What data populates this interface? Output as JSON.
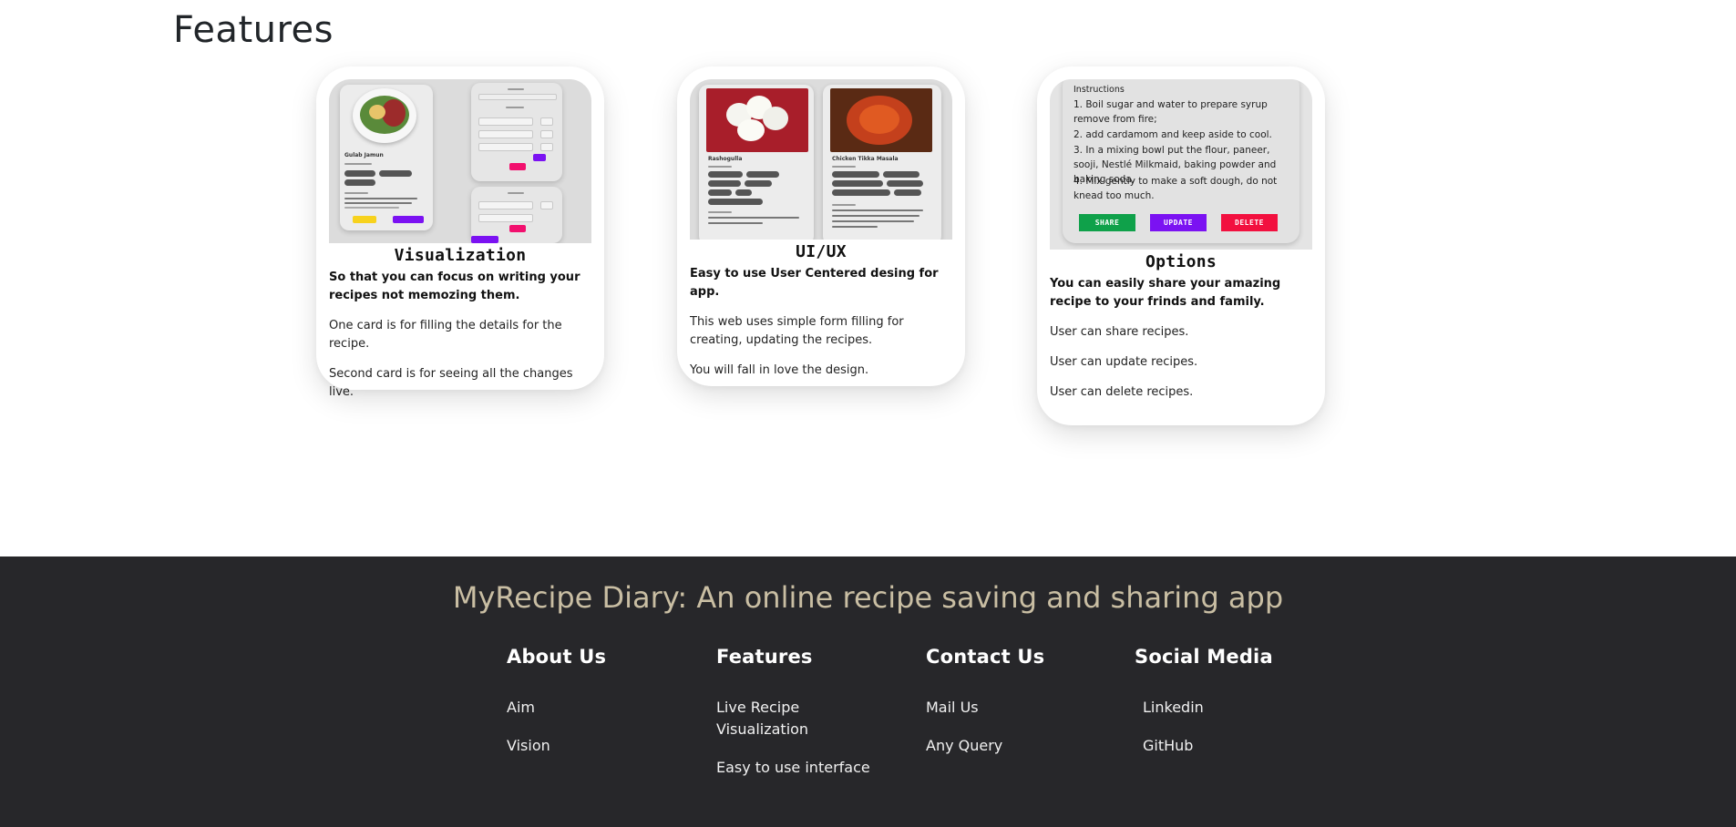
{
  "page": {
    "heading": "Features"
  },
  "cards": [
    {
      "title": "Visualization",
      "lead": "So that you can focus on writing your recipes not memozing them.",
      "paragraphs": [
        "One card is for filling the details for the recipe.",
        "Second card is for seeing all the changes live."
      ]
    },
    {
      "title": "UI/UX",
      "lead": "Easy to use User Centered desing for app.",
      "paragraphs": [
        "This web uses simple form filling for creating, updating the recipes.",
        "You will fall in love the design."
      ]
    },
    {
      "title": "Options",
      "lead": "You can easily share your amazing recipe to your frinds and family.",
      "paragraphs": [
        "User can share recipes.",
        "User can update recipes.",
        "User can delete recipes."
      ]
    }
  ],
  "options_preview": {
    "heading": "Instructions",
    "steps": [
      "1. Boil sugar and water to prepare syrup remove from fire;",
      "2. add cardamom and keep aside to cool.",
      "3. In a mixing bowl put the flour, paneer, sooji, Nestlé Milkmaid, baking powder and baking soda.",
      "4. Mix gently to make a soft dough, do not knead too much."
    ],
    "buttons": {
      "share": "SHARE",
      "update": "UPDATE",
      "delete": "DELETE"
    }
  },
  "uiux_preview": {
    "left_title": "Rashogulla",
    "right_title": "Chicken Tikka Masala"
  },
  "visualization_preview": {
    "title": "Gulab Jamun"
  },
  "footer": {
    "title": "MyRecipe Diary: An online recipe saving and sharing app",
    "columns": [
      {
        "heading": "About Us",
        "links": [
          "Aim",
          "Vision"
        ]
      },
      {
        "heading": "Features",
        "links": [
          "Live Recipe Visualization",
          "Easy to use interface"
        ]
      },
      {
        "heading": "Contact Us",
        "links": [
          "Mail Us",
          "Any Query"
        ]
      },
      {
        "heading": "Social Media",
        "links": [
          "Linkedin",
          "GitHub"
        ]
      }
    ]
  },
  "colors": {
    "footer_bg": "#27272a",
    "footer_title": "#c9bea3",
    "share": "#0fa14a",
    "update": "#7b12f2",
    "delete": "#f2103f"
  }
}
